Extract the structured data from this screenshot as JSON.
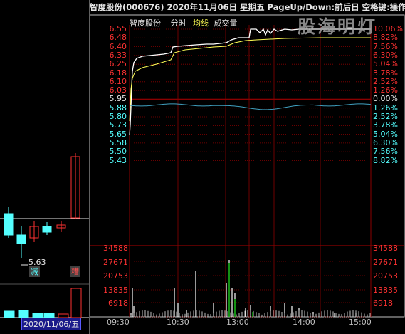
{
  "title_bar": "智度股份(000676)  2020年11月06日  星期五  PageUp/Down:前后日  空格键:操作",
  "watermark": "股海明灯",
  "sub_header": {
    "name": "智度股份",
    "mode": "分时",
    "avg_label": "均线",
    "vol_label": "成交量"
  },
  "colors": {
    "up": "#ff3232",
    "down": "#54ffff",
    "flat": "#e6e6e6",
    "avg": "#ffff55",
    "price": "#ffffff",
    "grid": "#8b0000",
    "frame": "#c0c0c0"
  },
  "price_axis": {
    "left": [
      "6.55",
      "6.48",
      "6.40",
      "6.33",
      "6.25",
      "6.18",
      "6.10",
      "6.03",
      "5.95",
      "5.88",
      "5.80",
      "5.73",
      "5.65",
      "5.58",
      "5.50",
      "5.43"
    ],
    "right": [
      "10.06%",
      "8.82%",
      "7.56%",
      "6.30%",
      "5.04%",
      "3.78%",
      "2.52%",
      "1.26%",
      "0.00%",
      "1.26%",
      "2.52%",
      "3.78%",
      "5.04%",
      "6.30%",
      "7.56%",
      "8.82%"
    ]
  },
  "volume_axis": [
    "34588",
    "27671",
    "20753",
    "13835",
    "6918"
  ],
  "time_axis": [
    "09:30",
    "10:30",
    "13:00",
    "14:00",
    "15:00"
  ],
  "kline": {
    "low_label": "5.63",
    "jian_tag": "减",
    "tiao_tag": "糟",
    "date_label": "2020/11/06/五"
  }
}
